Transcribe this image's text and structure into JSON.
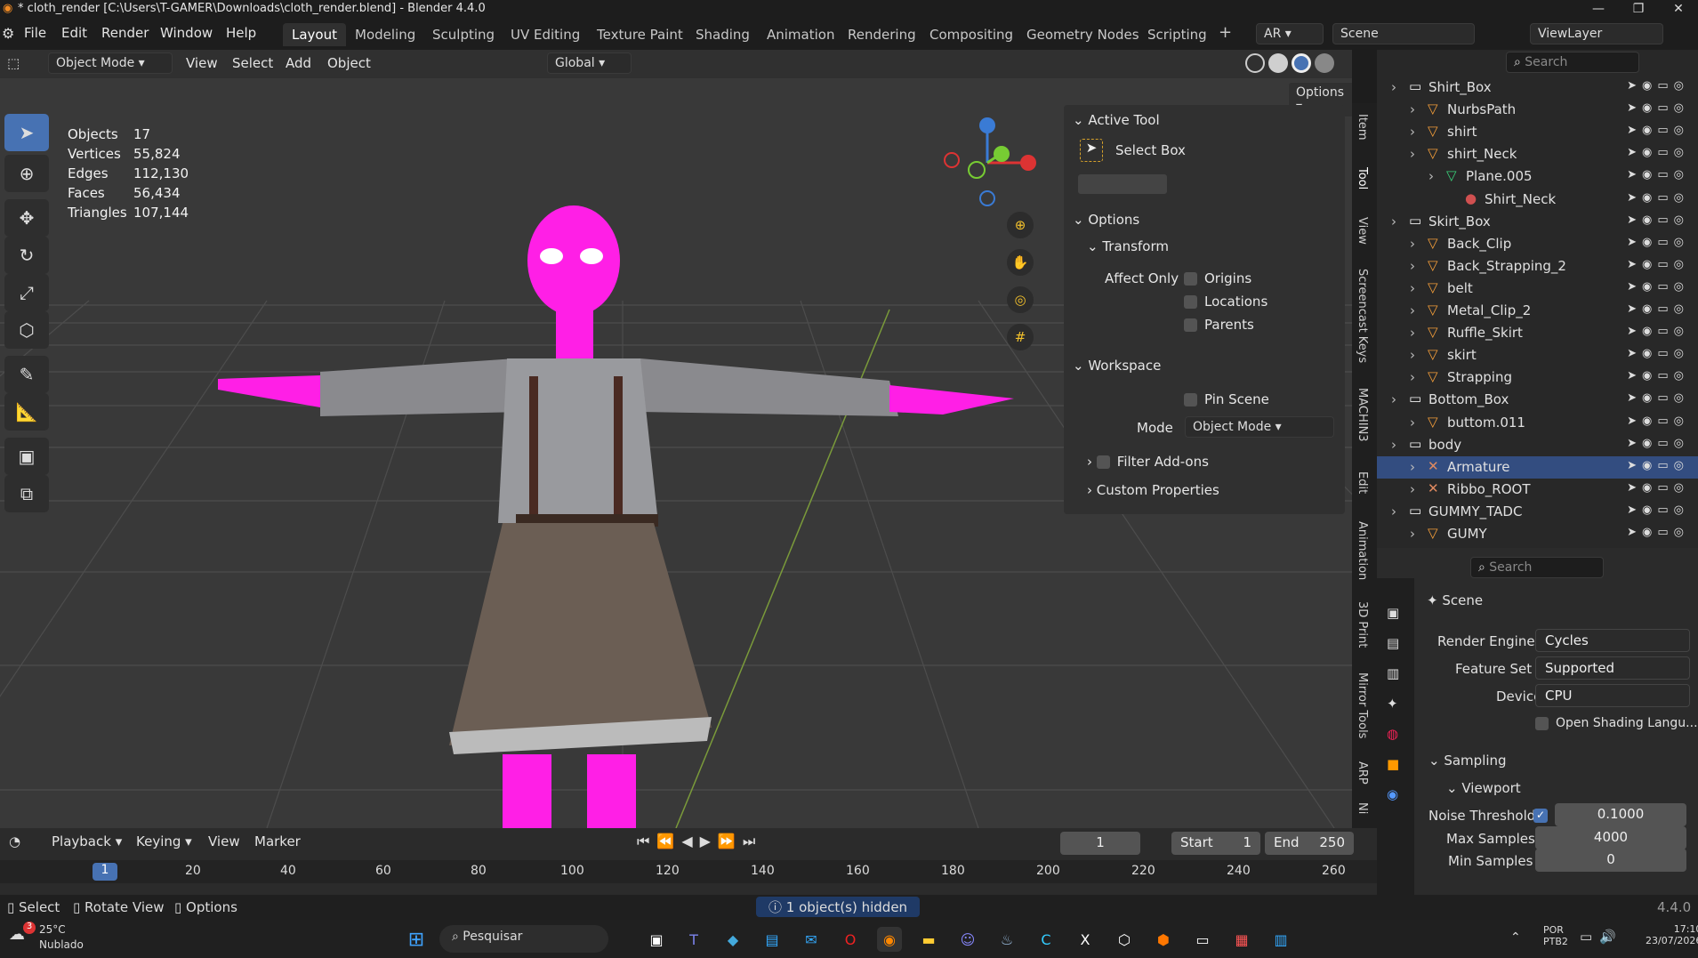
{
  "window": {
    "title": "* cloth_render [C:\\Users\\T-GAMER\\Downloads\\cloth_render.blend] - Blender 4.4.0",
    "minimize": "—",
    "maximize": "❐",
    "close": "✕"
  },
  "menus": [
    "File",
    "Edit",
    "Render",
    "Window",
    "Help"
  ],
  "workspaces": [
    "Layout",
    "Modeling",
    "Sculpting",
    "UV Editing",
    "Texture Paint",
    "Shading",
    "Animation",
    "Rendering",
    "Compositing",
    "Geometry Nodes",
    "Scripting"
  ],
  "top_right": {
    "ar": "AR",
    "scene": "Scene",
    "view_layer": "ViewLayer"
  },
  "viewport_header": {
    "mode": "Object Mode",
    "menus": [
      "View",
      "Select",
      "Add",
      "Object"
    ],
    "orientation": "Global",
    "options": "Options"
  },
  "stats": [
    {
      "label": "Objects",
      "value": "17"
    },
    {
      "label": "Vertices",
      "value": "55,824"
    },
    {
      "label": "Edges",
      "value": "112,130"
    },
    {
      "label": "Faces",
      "value": "56,434"
    },
    {
      "label": "Triangles",
      "value": "107,144"
    }
  ],
  "npanel": {
    "active_tool": "Active Tool",
    "select_box": "Select Box",
    "options": "Options",
    "transform": "Transform",
    "affect_only": "Affect Only",
    "origins": "Origins",
    "locations": "Locations",
    "parents": "Parents",
    "workspace": "Workspace",
    "pin_scene": "Pin Scene",
    "mode_label": "Mode",
    "mode_value": "Object Mode",
    "filter_addons": "Filter Add-ons",
    "custom_props": "Custom Properties"
  },
  "side_tabs": [
    "Item",
    "Tool",
    "View",
    "Screencast Keys",
    "MACHIN3",
    "Edit",
    "Animation",
    "3D Print",
    "Mirror Tools",
    "ARP",
    "Ni"
  ],
  "outliner": {
    "search": "Search",
    "rows": [
      {
        "name": "Shirt_Box",
        "indent": 0,
        "icon": "collection"
      },
      {
        "name": "NurbsPath",
        "indent": 1,
        "icon": "object"
      },
      {
        "name": "shirt",
        "indent": 1,
        "icon": "object"
      },
      {
        "name": "shirt_Neck",
        "indent": 1,
        "icon": "object"
      },
      {
        "name": "Plane.005",
        "indent": 2,
        "icon": "mesh"
      },
      {
        "name": "Shirt_Neck",
        "indent": 3,
        "icon": "material"
      },
      {
        "name": "Skirt_Box",
        "indent": 0,
        "icon": "collection"
      },
      {
        "name": "Back_Clip",
        "indent": 1,
        "icon": "object"
      },
      {
        "name": "Back_Strapping_2",
        "indent": 1,
        "icon": "object"
      },
      {
        "name": "belt",
        "indent": 1,
        "icon": "object"
      },
      {
        "name": "Metal_Clip_2",
        "indent": 1,
        "icon": "object"
      },
      {
        "name": "Ruffle_Skirt",
        "indent": 1,
        "icon": "object"
      },
      {
        "name": "skirt",
        "indent": 1,
        "icon": "object"
      },
      {
        "name": "Strapping",
        "indent": 1,
        "icon": "object"
      },
      {
        "name": "Bottom_Box",
        "indent": 0,
        "icon": "collection"
      },
      {
        "name": "buttom.011",
        "indent": 1,
        "icon": "object"
      },
      {
        "name": "body",
        "indent": 0,
        "icon": "collection"
      },
      {
        "name": "Armature",
        "indent": 1,
        "icon": "armature",
        "selected": true
      },
      {
        "name": "Ribbo_ROOT",
        "indent": 1,
        "icon": "armature"
      },
      {
        "name": "GUMMY_TADC",
        "indent": 0,
        "icon": "collection"
      },
      {
        "name": "GUMY",
        "indent": 1,
        "icon": "object"
      }
    ]
  },
  "properties": {
    "search": "Search",
    "scene": "Scene",
    "render_engine_label": "Render Engine",
    "render_engine": "Cycles",
    "feature_set_label": "Feature Set",
    "feature_set": "Supported",
    "device_label": "Device",
    "device": "CPU",
    "open_shading": "Open Shading Langu...",
    "sampling": "Sampling",
    "viewport": "Viewport",
    "noise_threshold_label": "Noise Threshold",
    "noise_threshold": "0.1000",
    "max_samples_label": "Max Samples",
    "max_samples": "4000",
    "min_samples_label": "Min Samples",
    "min_samples": "0"
  },
  "timeline": {
    "menus": [
      "Playback",
      "Keying",
      "View",
      "Marker"
    ],
    "current_frame": "1",
    "start_label": "Start",
    "start": "1",
    "end_label": "End",
    "end": "250",
    "ticks": [
      "1",
      "20",
      "40",
      "60",
      "80",
      "100",
      "120",
      "140",
      "160",
      "180",
      "200",
      "220",
      "240",
      "260"
    ]
  },
  "status": {
    "select": "Select",
    "rotate": "Rotate View",
    "options": "Options",
    "message": "1 object(s) hidden",
    "version": "4.4.0"
  },
  "taskbar": {
    "temp": "25°C",
    "weather": "Nublado",
    "search": "Pesquisar",
    "lang1": "POR",
    "lang2": "PTB2",
    "time": "17:10",
    "date": "23/07/2026",
    "badge": "3"
  }
}
